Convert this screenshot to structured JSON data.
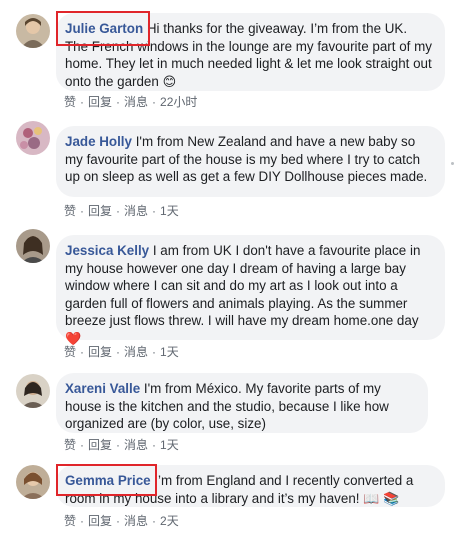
{
  "actions": {
    "like": "赞",
    "reply": "回复",
    "message": "消息",
    "sep": "·"
  },
  "comments": [
    {
      "author": "Julie Garton",
      "text": " Hi thanks for the giveaway. I’m from the UK. The French windows in the lounge are my favourite part of my home. They let in much needed light & let me look straight out onto the garden",
      "emoji": "😊",
      "time": "22小时",
      "highlighted": true,
      "avatar_color": "#9a8f7a"
    },
    {
      "author": "Jade Holly",
      "text": " I'm from New Zealand and have a new baby so my favourite part of the house is my bed where I try to catch up on sleep as well as get a few DIY Dollhouse pieces made.",
      "emoji": "",
      "time": "1天",
      "highlighted": false,
      "avatar_color": "#b07d8f"
    },
    {
      "author": "Jessica Kelly",
      "text": " I am from UK I don't have a favourite place in my house however one day I dream of having a large bay window where I can sit and do my art as I look out into a garden full of flowers and animals playing. As the summer breeze just flows threw. I will have my dream home.one day",
      "emoji": "❤️",
      "time": "1天",
      "highlighted": false,
      "avatar_color": "#6b5a4a"
    },
    {
      "author": "Xareni Valle",
      "text": " I'm from México. My favorite parts of my house is the kitchen and the studio, because I like how organized are (by color, use, size)",
      "emoji": "",
      "time": "1天",
      "highlighted": false,
      "avatar_color": "#5a5148"
    },
    {
      "author": "Gemma Price",
      "text": " I’m from England and I recently converted a room in my house into a library and it’s my haven!",
      "emoji": "📖 📚",
      "time": "2天",
      "highlighted": true,
      "avatar_color": "#8a7a66"
    }
  ]
}
